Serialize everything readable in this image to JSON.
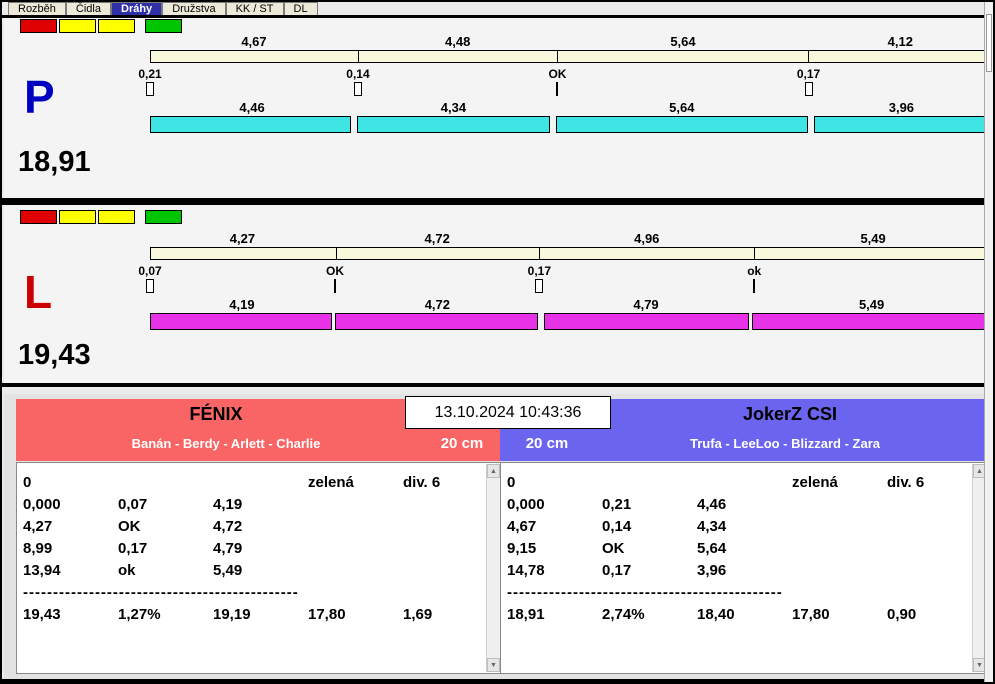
{
  "tabs": [
    {
      "label": "Rozběh",
      "selected": false
    },
    {
      "label": "Čidla",
      "selected": false
    },
    {
      "label": "Dráhy",
      "selected": true
    },
    {
      "label": "Družstva",
      "selected": false
    },
    {
      "label": "KK / ST",
      "selected": false
    },
    {
      "label": "DL",
      "selected": false
    }
  ],
  "datetime": "13.10.2024 10:43:36",
  "colors": {
    "cyan_bar": "#3FE4E4",
    "magenta_bar": "#E832E8",
    "cream_bar": "#F8F8DC",
    "left_header": "#F96464",
    "right_header": "#6A64EE",
    "p_letter": "#0000C0",
    "l_letter": "#CC0000",
    "status_lights": [
      "#DF0000",
      "#FFFF00",
      "#FFFF00",
      "#00C400"
    ]
  },
  "lanes": [
    {
      "letter": "P",
      "total": "18,91",
      "top_splits": [
        "4,67",
        "4,48",
        "5,64",
        "4,12"
      ],
      "markers": [
        "0,21",
        "0,14",
        "OK",
        "0,17"
      ],
      "bottom_splits": [
        "4,46",
        "4,34",
        "5,64",
        "3,96"
      ],
      "bar_color": "#3FE4E4"
    },
    {
      "letter": "L",
      "total": "19,43",
      "top_splits": [
        "4,27",
        "4,72",
        "4,96",
        "5,49"
      ],
      "markers": [
        "0,07",
        "OK",
        "0,17",
        "ok"
      ],
      "bottom_splits": [
        "4,19",
        "4,72",
        "4,79",
        "5,49"
      ],
      "bar_color": "#E832E8"
    }
  ],
  "teams": [
    {
      "name": "FÉNIX",
      "members": "Banán - Berdy - Arlett - Charlie",
      "height": "20 cm",
      "info": {
        "col1": "0",
        "color_label": "zelená",
        "division": "div. 6"
      },
      "rows": [
        [
          "0,000",
          "0,07",
          "4,19"
        ],
        [
          "4,27",
          "OK",
          "4,72"
        ],
        [
          "8,99",
          "0,17",
          "4,79"
        ],
        [
          "13,94",
          "ok",
          "5,49"
        ]
      ],
      "separator": "----------------------------------------------",
      "summary": [
        "19,43",
        "1,27%",
        "19,19",
        "17,80",
        "1,69"
      ]
    },
    {
      "name": "JokerZ CSI",
      "members": "Trufa - LeeLoo - Blizzard - Zara",
      "height": "20 cm",
      "info": {
        "col1": "0",
        "color_label": "zelená",
        "division": "div. 6"
      },
      "rows": [
        [
          "0,000",
          "0,21",
          "4,46"
        ],
        [
          "4,67",
          "0,14",
          "4,34"
        ],
        [
          "9,15",
          "OK",
          "5,64"
        ],
        [
          "14,78",
          "0,17",
          "3,96"
        ]
      ],
      "separator": "----------------------------------------------",
      "summary": [
        "18,91",
        "2,74%",
        "18,40",
        "17,80",
        "0,90"
      ]
    }
  ]
}
